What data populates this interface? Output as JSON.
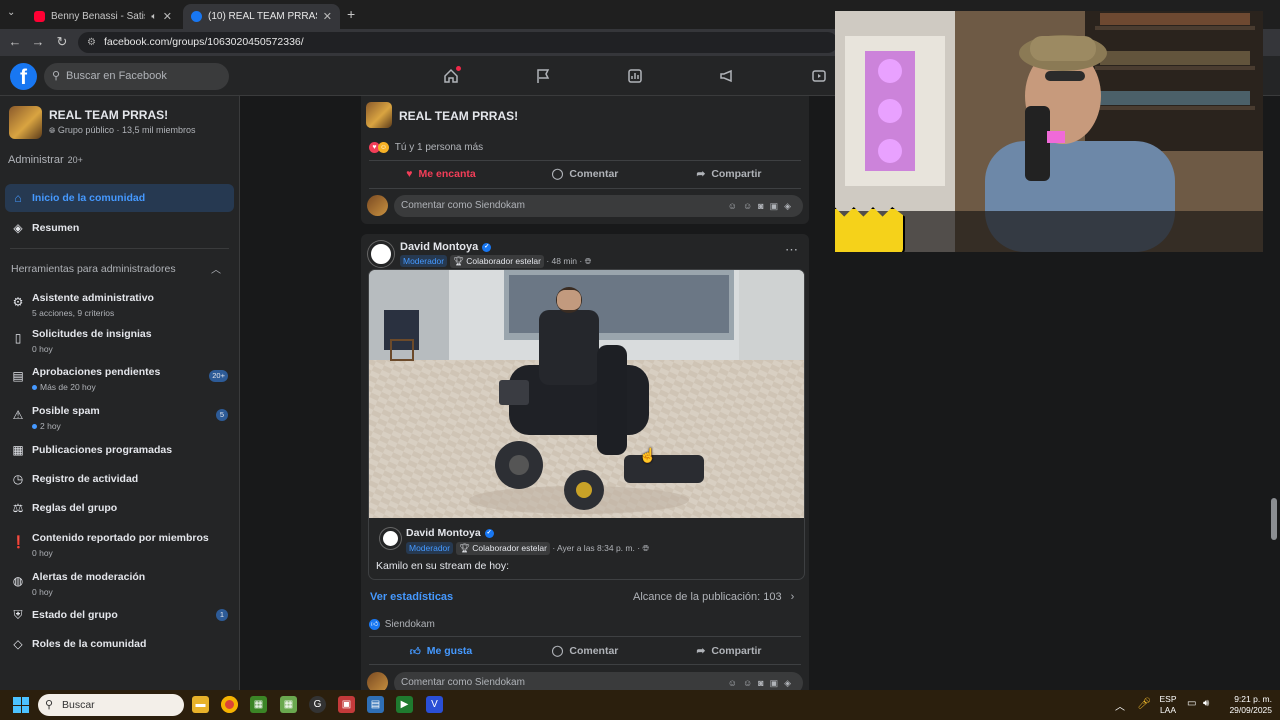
{
  "browser": {
    "tabs": [
      {
        "title": "Benny Benassi - Satisfactio",
        "favicon_color": "#ff0033"
      },
      {
        "title": "(10) REAL TEAM PRRAS! | Faceb",
        "favicon_color": "#1877f2"
      }
    ],
    "url": "facebook.com/groups/1063020450572336/"
  },
  "facebook": {
    "logo": "f",
    "search_placeholder": "Buscar en Facebook"
  },
  "sidebar": {
    "group_name": "REAL TEAM PRRAS!",
    "group_meta": "Grupo público · 13,5 mil miembros",
    "admin_label": "Administrar",
    "admin_count": "20+",
    "nav": [
      {
        "label": "Inicio de la comunidad",
        "icon": "home-icon"
      },
      {
        "label": "Resumen",
        "icon": "layers-icon"
      }
    ],
    "tools_header": "Herramientas para administradores",
    "tools": [
      {
        "label": "Asistente administrativo",
        "sub": "5 acciones, 9 criterios",
        "icon": "gear-icon"
      },
      {
        "label": "Solicitudes de insignias",
        "sub": "0 hoy",
        "icon": "badge-icon"
      },
      {
        "label": "Aprobaciones pendientes",
        "sub": "Más de 20 hoy",
        "badge": "20+",
        "icon": "approval-icon"
      },
      {
        "label": "Posible spam",
        "sub": "2 hoy",
        "badge": "5",
        "icon": "warning-icon"
      },
      {
        "label": "Publicaciones programadas",
        "icon": "calendar-icon"
      },
      {
        "label": "Registro de actividad",
        "icon": "clock-icon"
      },
      {
        "label": "Reglas del grupo",
        "icon": "rules-icon"
      },
      {
        "label": "Contenido reportado por miembros",
        "sub": "0 hoy",
        "icon": "report-icon"
      },
      {
        "label": "Alertas de moderación",
        "sub": "0 hoy",
        "icon": "alert-icon"
      },
      {
        "label": "Estado del grupo",
        "badge": "1",
        "icon": "status-icon"
      },
      {
        "label": "Roles de la comunidad",
        "icon": "roles-icon"
      }
    ]
  },
  "post1": {
    "group_name": "REAL TEAM PRRAS!",
    "reactions_text": "Tú y 1 persona más",
    "love_label": "Me encanta",
    "comment_label": "Comentar",
    "share_label": "Compartir",
    "comment_placeholder": "Comentar como Siendokam"
  },
  "post2": {
    "author": "David Montoya",
    "role_badge": "Moderador",
    "star_badge": "Colaborador estelar",
    "time": "· 48 min ·",
    "shared_author": "David Montoya",
    "shared_role": "Moderador",
    "shared_star": "Colaborador estelar",
    "shared_time": "· Ayer a las 8:34 p. m. ·",
    "shared_text": "Kamilo en su stream de hoy:",
    "stats_link": "Ver estadísticas",
    "reach_text": "Alcance de la publicación: 103",
    "liker": "Siendokam",
    "like_label": "Me gusta",
    "comment_label": "Comentar",
    "share_label": "Compartir",
    "comment_placeholder": "Comentar como Siendokam"
  },
  "taskbar": {
    "search_label": "Buscar",
    "lang_top": "ESP",
    "lang_bottom": "LAA",
    "time": "9:21 p. m.",
    "date": "29/09/2025"
  }
}
